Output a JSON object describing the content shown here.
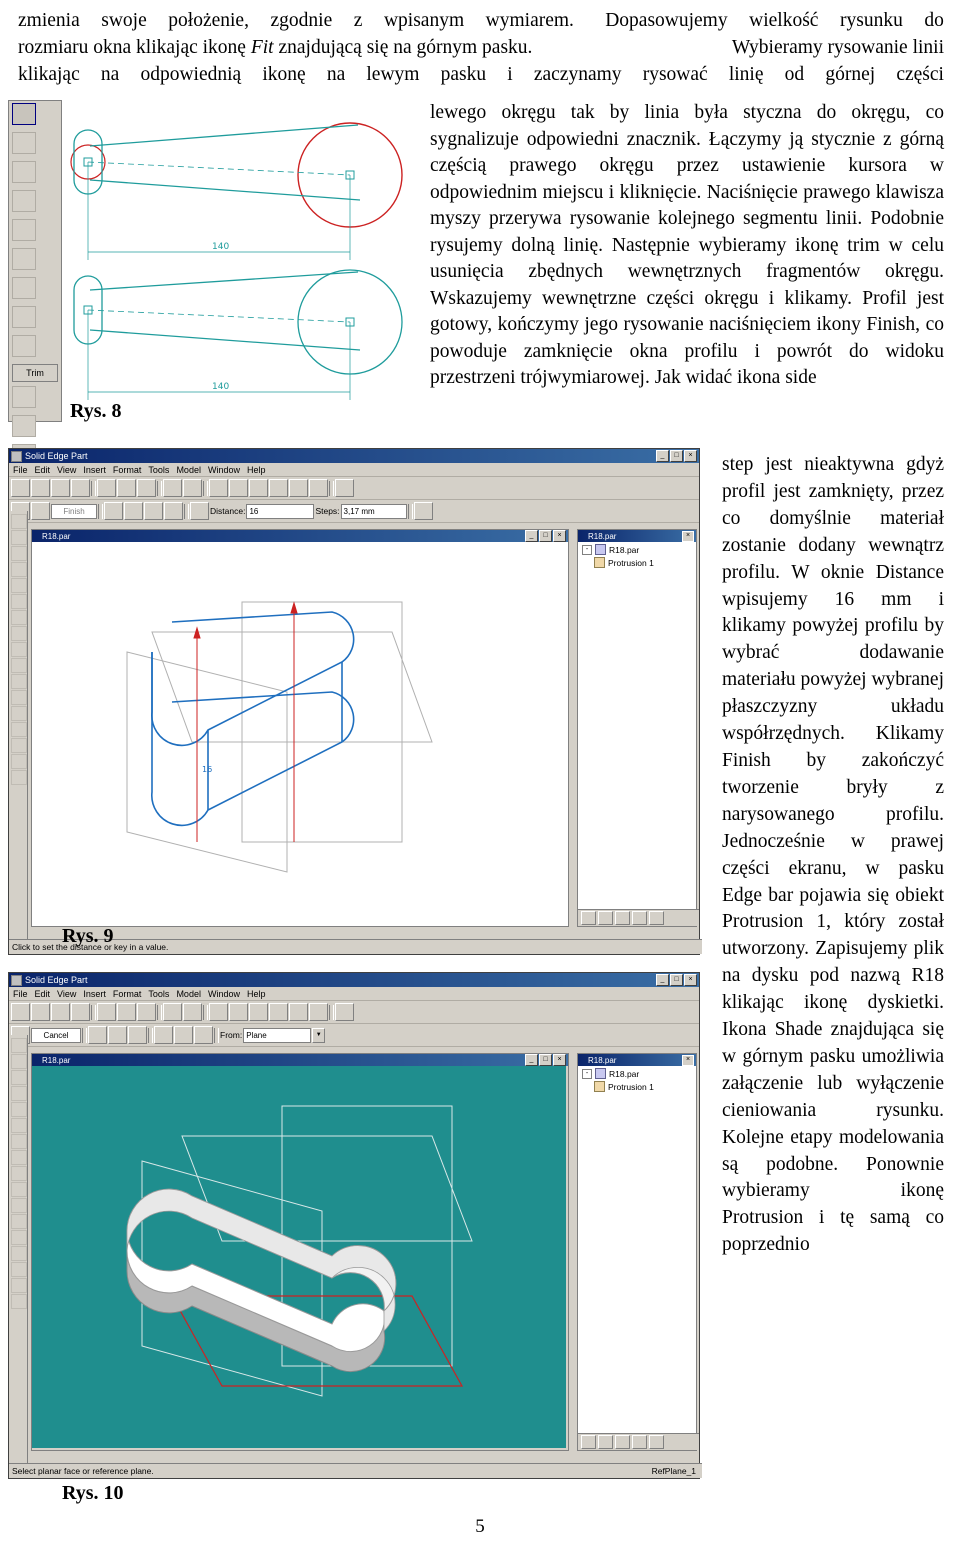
{
  "document": {
    "page_number": "5",
    "top_paragraph_lines": [
      "zmienia swoje położenie, zgodnie z wpisanym wymiarem.  Dopasowujemy wielkość rysunku do",
      "rozmiaru okna klikając ikonę Fit znajdującą się na górnym pasku.",
      "Wybieramy rysowanie linii",
      "klikając na odpowiednią ikonę na lewym pasku i zaczynamy rysować linię od górnej części"
    ],
    "right_column_text": "lewego okręgu tak by linia była styczna do okręgu, co sygnalizuje odpowiedni znacznik. Łączymy ją stycznie z górną częścią prawego okręgu przez ustawienie kursora w odpowiednim miejscu i kliknięcie. Naciśnięcie prawego klawisza myszy przerywa rysowanie kolejnego segmentu linii. Podobnie rysujemy dolną linię. Następnie wybieramy ikonę trim w celu usunięcia zbędnych wewnętrznych fragmentów okręgu. Wskazujemy wewnętrzne części okręgu i klikamy. Profil jest gotowy, kończymy jego rysowanie naciśnięciem ikony Finish, co powoduje zamknięcie okna profilu i powrót do widoku przestrzeni trójwymiarowej. Jak widać ikona side",
    "narrow_column_text": "step jest nieaktywna gdyż profil jest zamknięty, przez co domyślnie materiał zostanie dodany wewnątrz profilu. W oknie Distance wpisujemy 16 mm i klikamy powyżej profilu by wybrać dodawanie materiału powyżej wybranej płaszczyzny układu współrzędnych. Klikamy Finish by zakończyć tworzenie bryły z narysowanego profilu. Jednocześnie w prawej części ekranu, w pasku Edge bar pojawia się obiekt Protrusion 1, który został utworzony. Zapisujemy plik na dysku pod nazwą R18 klikając ikonę dyskietki. Ikona Shade znajdująca się w górnym pasku umożliwia załączenie lub wyłączenie cieniowania rysunku. Kolejne etapy modelowania są podobne. Ponownie wybieramy ikonę Protrusion i tę samą co poprzednio",
    "italic_terms": [
      "Fit",
      "trim",
      "Finish",
      "side step",
      "Distance",
      "Finish",
      "Edge bar",
      "Protrusion 1",
      "Shade",
      "Protrusion"
    ]
  },
  "figures": {
    "fig8": {
      "caption": "Rys. 8",
      "trim_button_label": "Trim",
      "dimension_labels": [
        "140",
        "140"
      ],
      "sketch_color": "#1f9c9c",
      "circle_highlight_color": "#cc2222"
    },
    "fig9": {
      "caption": "Rys. 9",
      "window_title": "Solid Edge Part",
      "menu": [
        "File",
        "Edit",
        "View",
        "Insert",
        "Format",
        "Tools",
        "Model",
        "Window",
        "Help"
      ],
      "child_window_title": "R18.par",
      "ribbon": {
        "finish_label": "Finish",
        "distance_label": "Distance:",
        "distance_value": "16",
        "steps_label": "Steps:",
        "steps_value": "3,17 mm"
      },
      "edge_bar": {
        "title": "R18.par",
        "items": [
          "R18.par",
          "Protrusion 1"
        ]
      },
      "status_text": "Click to set the distance or key in a value.",
      "background_color": "#ffffff",
      "model_line_color": "#1f6fbf",
      "dim_line_color": "#cc2222"
    },
    "fig10": {
      "caption": "Rys. 10",
      "window_title": "Solid Edge Part",
      "menu": [
        "File",
        "Edit",
        "View",
        "Insert",
        "Format",
        "Tools",
        "Model",
        "Window",
        "Help"
      ],
      "child_window_title": "R18.par",
      "ribbon": {
        "cancel_label": "Cancel",
        "from_label": "From:",
        "from_value": "Plane"
      },
      "edge_bar": {
        "title": "R18.par",
        "items": [
          "R18.par",
          "Protrusion 1"
        ]
      },
      "status_text": "Select planar face or reference plane.",
      "status_right": "RefPlane_1",
      "viewport_color": "#1f8e8e",
      "solid_color": "#f2f2f2",
      "ref_plane_color": "#cc2222"
    }
  }
}
